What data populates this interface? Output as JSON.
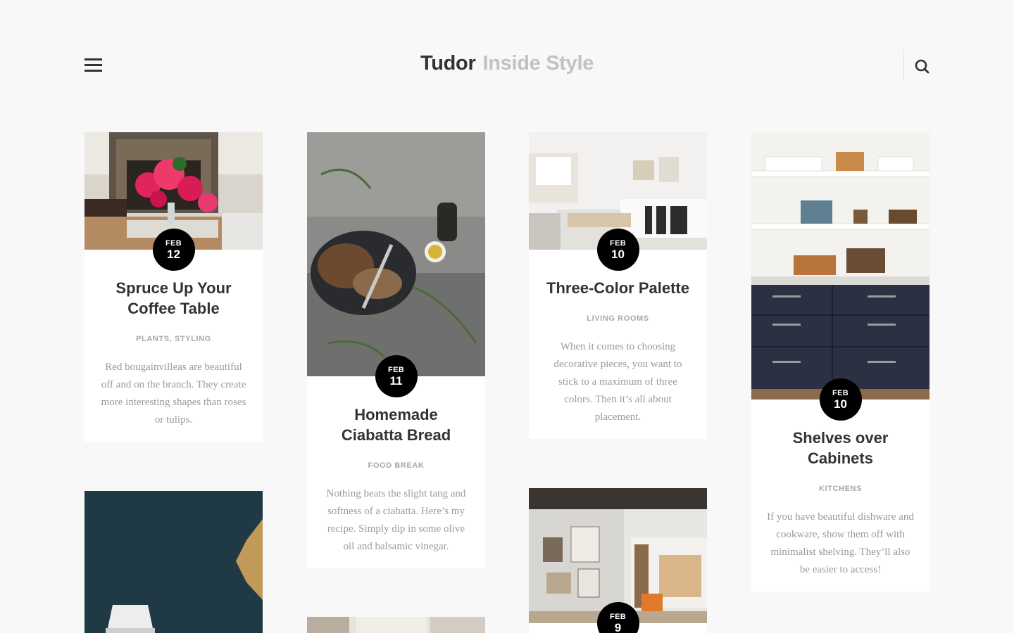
{
  "header": {
    "brand": "Tudor",
    "tagline": "Inside Style",
    "menu_icon": "hamburger-menu-icon",
    "search_icon": "search-icon"
  },
  "posts": [
    {
      "month": "FEB",
      "day": "12",
      "title": "Spruce Up Your Coffee Table",
      "categories": "PLANTS, STYLING",
      "excerpt": "Red bougainvilleas are beautiful off and on the branch. They create more interesting shapes than roses or tulips."
    },
    {
      "month": "FEB",
      "day": "11",
      "title": "Homemade Ciabatta Bread",
      "categories": "FOOD BREAK",
      "excerpt": "Nothing beats the slight tang and softness of a ciabatta. Here’s my recipe. Simply dip in some olive oil and balsamic vinegar."
    },
    {
      "month": "FEB",
      "day": "10",
      "title": "Three-Color Palette",
      "categories": "LIVING ROOMS",
      "excerpt": "When it comes to choosing decorative pieces, you want to stick to a maximum of three colors. Then it’s all about placement."
    },
    {
      "month": "FEB",
      "day": "10",
      "title": "Shelves over Cabinets",
      "categories": "KITCHENS",
      "excerpt": "If you have beautiful dishware and cookware, show them off with minimalist shelving. They’ll also be easier to access!"
    },
    {
      "month": "FEB",
      "day": "9"
    }
  ],
  "colors": {
    "background": "#f8f8f8",
    "badge": "#000000",
    "title": "#333333",
    "muted": "#a8a8a8",
    "logo_secondary": "#c2c2c2"
  }
}
